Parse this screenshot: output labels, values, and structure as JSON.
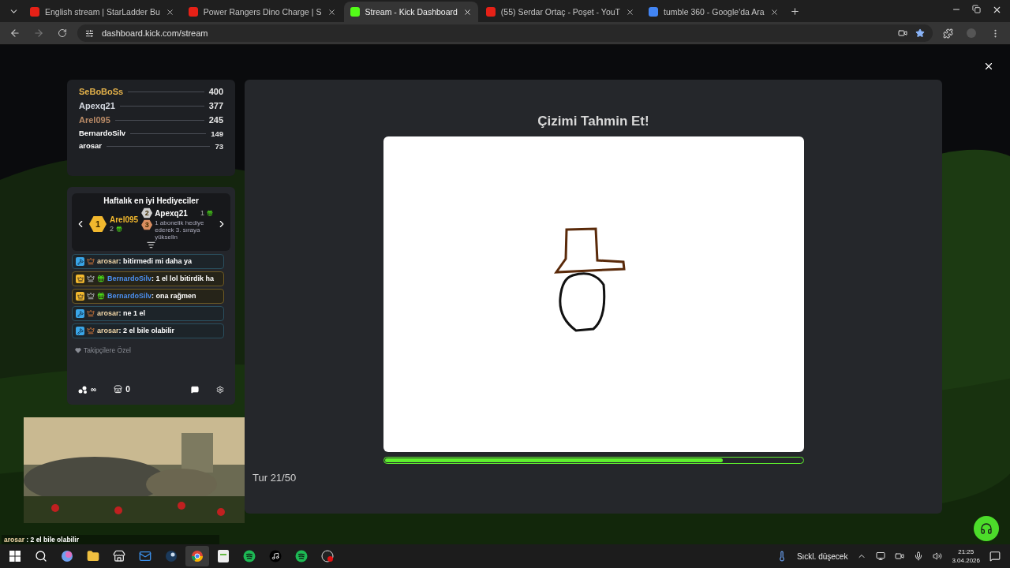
{
  "browser": {
    "tabs": [
      {
        "title": "English stream | StarLadder Bu",
        "kind": "youtube",
        "selected": false
      },
      {
        "title": "Power Rangers Dino Charge | S",
        "kind": "youtube",
        "selected": false
      },
      {
        "title": "Stream - Kick Dashboard",
        "kind": "kick",
        "selected": true
      },
      {
        "title": "(55) Serdar Ortaç - Poşet - YouT",
        "kind": "youtube",
        "selected": false
      },
      {
        "title": "tumble 360 - Google'da Ara",
        "kind": "google",
        "selected": false
      }
    ],
    "url": "dashboard.kick.com/stream"
  },
  "leaderboard": [
    {
      "name": "SeBoBoSs",
      "score": "400",
      "color": "#e2b04a",
      "kind": "top"
    },
    {
      "name": "Apexq21",
      "score": "377",
      "color": "#d4d8e0",
      "kind": "top"
    },
    {
      "name": "Arel095",
      "score": "245",
      "color": "#b98a66",
      "kind": "top"
    },
    {
      "name": "BernardoSilv",
      "score": "149",
      "color": "#ffffff",
      "kind": "regular"
    },
    {
      "name": "arosar",
      "score": "73",
      "color": "#ffffff",
      "kind": "regular"
    }
  ],
  "gifters": {
    "title": "Haftalık en iyi Hediyeciler",
    "first": {
      "rank": "1",
      "name": "Arel095",
      "count": "2"
    },
    "second": {
      "rank": "2",
      "name": "Apexq21",
      "count": "1"
    },
    "third": {
      "rank": "3",
      "text": "1 abonelik hediye ederek 3. sıraya yükselin"
    }
  },
  "messages": [
    {
      "kind": "mod",
      "user": "arosar",
      "text": ": bitirmedi mi daha ya"
    },
    {
      "kind": "vip",
      "user": "BernardoSilv",
      "text": ": 1 el lol bitirdik ha"
    },
    {
      "kind": "vip",
      "user": "BernardoSilv",
      "text": ": ona rağmen"
    },
    {
      "kind": "mod",
      "user": "arosar",
      "text": ": ne 1 el"
    },
    {
      "kind": "mod",
      "user": "arosar",
      "text": ": 2 el bile olabilir"
    }
  ],
  "chat_mode": "Takipçilere Özel",
  "chat_footer": {
    "viewers": "∞",
    "points": "0"
  },
  "game": {
    "title": "Çizimi Tahmin Et!",
    "progress": {
      "level": 0.81
    },
    "round": "Tur 21/50"
  },
  "overlay_chat": {
    "user": "arosar",
    "text": " : 2 el bile olabilir"
  },
  "tray": {
    "weather": "Sıckl. düşecek",
    "time": "21:25",
    "date": "3.04.2026"
  }
}
